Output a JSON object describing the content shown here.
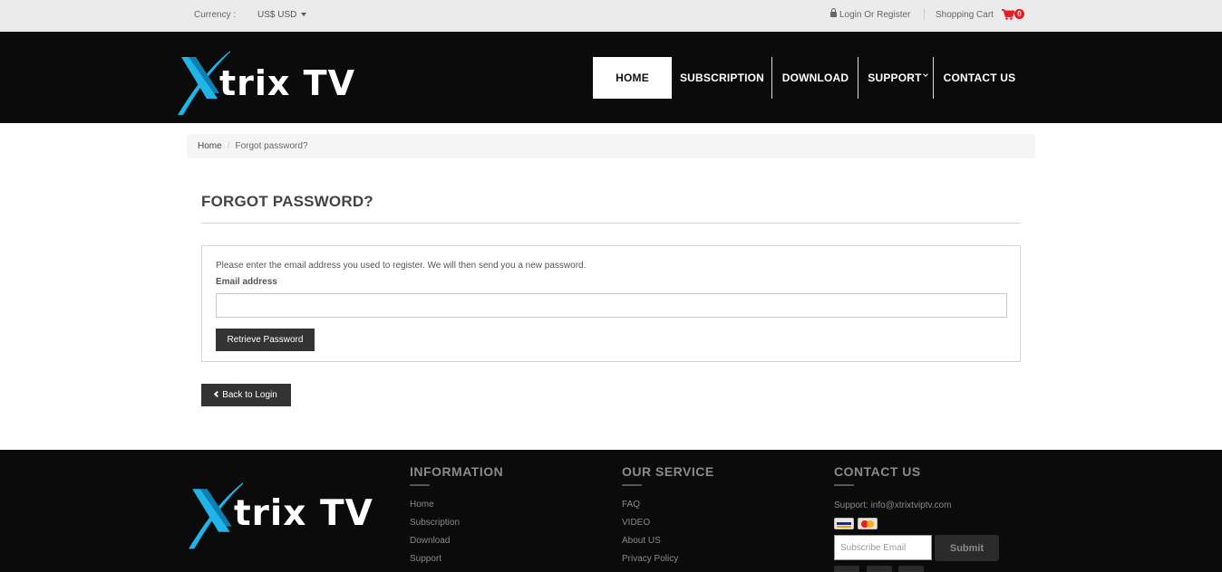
{
  "topbar": {
    "currency_label": "Currency :",
    "currency_value": "US$ USD",
    "login_text": "Login Or Register",
    "cart_label": "Shopping Cart",
    "cart_count": "0"
  },
  "header": {
    "logo_text": "trix TV",
    "nav": [
      {
        "label": "HOME"
      },
      {
        "label": "SUBSCRIPTION"
      },
      {
        "label": "DOWNLOAD"
      },
      {
        "label": "SUPPORT"
      },
      {
        "label": "CONTACT US"
      }
    ]
  },
  "breadcrumb": {
    "home": "Home",
    "separator": "/",
    "current": "Forgot password?"
  },
  "main": {
    "title": "FORGOT PASSWORD?",
    "instructions": "Please enter the email address you used to register. We will then send you a new password.",
    "email_label": "Email address",
    "email_value": "",
    "retrieve_label": "Retrieve Password",
    "back_label": "Back to Login"
  },
  "footer": {
    "logo_text": "trix TV",
    "information": {
      "heading": "INFORMATION",
      "links": [
        "Home",
        "Subscription",
        "Download",
        "Support"
      ]
    },
    "service": {
      "heading": "OUR SERVICE",
      "links": [
        "FAQ",
        "VIDEO",
        "About US",
        "Privacy Policy"
      ]
    },
    "contact": {
      "heading": "CONTACT US",
      "support": "Support: info@xtrixtviptv.com",
      "subscribe_placeholder": "Subscribe Email",
      "submit_label": "Submit"
    }
  },
  "colors": {
    "header_bg": "#0b0b0b",
    "logo_accent": "#1fb5e8",
    "cart_icon": "#e41b23",
    "button_dark": "#333333"
  },
  "icons": [
    "lock-icon",
    "caret-down-icon",
    "cart-icon",
    "chevron-left-icon",
    "visa-card-icon",
    "mastercard-icon"
  ]
}
